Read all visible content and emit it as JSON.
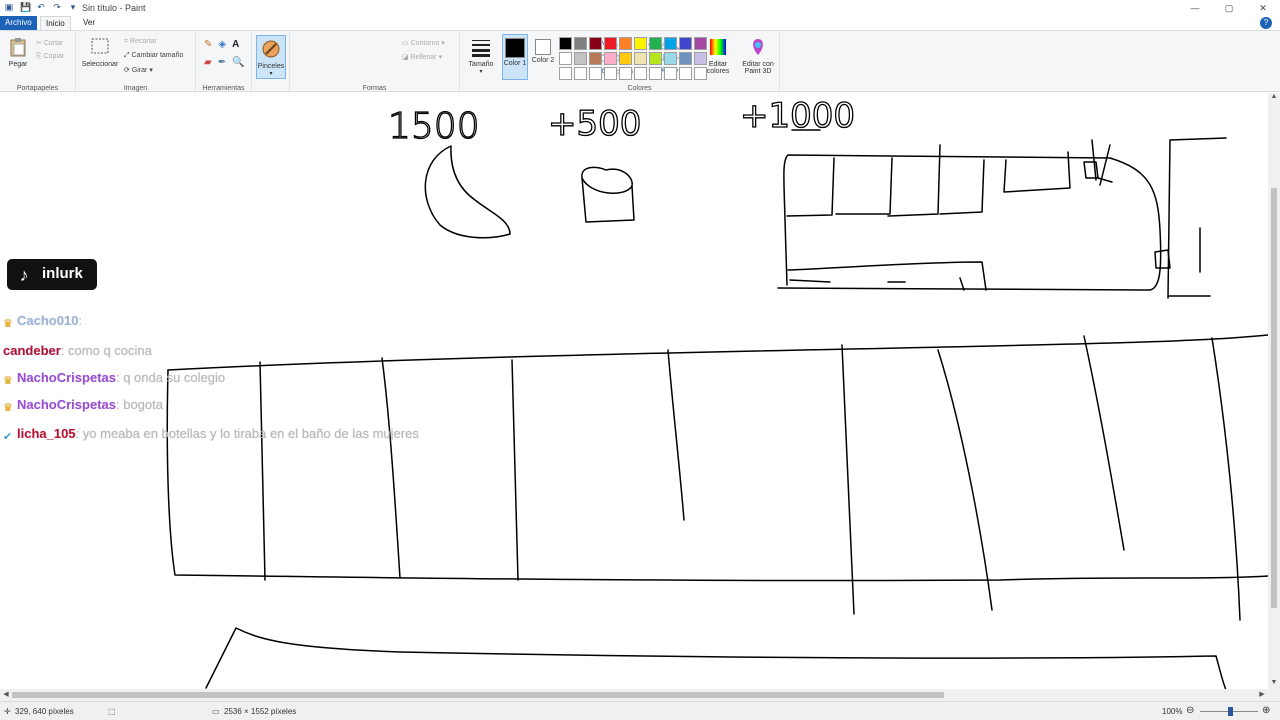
{
  "titlebar": {
    "title": "Sin título - Paint",
    "minimize": "—",
    "maximize": "▢",
    "close": "✕"
  },
  "menu": {
    "file": "Archivo",
    "home": "Inicio",
    "view": "Ver",
    "help": "?"
  },
  "ribbon": {
    "clipboard": {
      "label": "Portapapeles",
      "paste": "Pegar",
      "cut": "Cortar",
      "copy": "Copiar"
    },
    "image": {
      "label": "Imagen",
      "select": "Seleccionar",
      "crop": "Recortar",
      "resize": "Cambiar tamaño",
      "rotate": "Girar"
    },
    "tools": {
      "label": "Herramientas"
    },
    "brushes": {
      "label": "Pinceles"
    },
    "shapes": {
      "label": "Formas",
      "outline": "Contorno",
      "fill": "Rellenar"
    },
    "size": {
      "label": "Tamaño"
    },
    "colors": {
      "label": "Colores",
      "color1": "Color 1",
      "color2": "Color 2",
      "edit": "Editar colores",
      "paint3d": "Editar con Paint 3D",
      "color1_value": "#000000",
      "color2_value": "#ffffff",
      "palette": [
        "#000000",
        "#7f7f7f",
        "#880015",
        "#ed1c24",
        "#ff7f27",
        "#fff200",
        "#22b14c",
        "#00a2e8",
        "#3f48cc",
        "#a349a4",
        "#ffffff",
        "#c3c3c3",
        "#b97a57",
        "#ffaec9",
        "#ffc90e",
        "#efe4b0",
        "#b5e61d",
        "#99d9ea",
        "#7092be",
        "#c8bfe7",
        "#ffffff",
        "#ffffff",
        "#ffffff",
        "#ffffff",
        "#ffffff",
        "#ffffff",
        "#ffffff",
        "#ffffff",
        "#ffffff",
        "#ffffff"
      ]
    }
  },
  "canvas": {
    "numbers": [
      "1500",
      "+500",
      "+1000"
    ]
  },
  "overlay": {
    "tiktok_name": "inlurk",
    "chat": [
      {
        "user": "Cacho010",
        "user_color": "#9fb4d8",
        "message": ""
      },
      {
        "user": "candeber",
        "user_color": "#b0103a",
        "message": "como q cocina"
      },
      {
        "user": "NachoCrispetas",
        "user_color": "#9b4fd6",
        "message": "q onda su colegio"
      },
      {
        "user": "NachoCrispetas",
        "user_color": "#9b4fd6",
        "message": "bogota"
      },
      {
        "user": "licha_105",
        "user_color": "#c0102f",
        "message": "yo meaba en botellas y lo tiraba en el baño de las mujeres"
      }
    ]
  },
  "status": {
    "cursor": "329, 640 píxeles",
    "dimensions": "2536 × 1552 píxeles",
    "zoom": "100%"
  }
}
